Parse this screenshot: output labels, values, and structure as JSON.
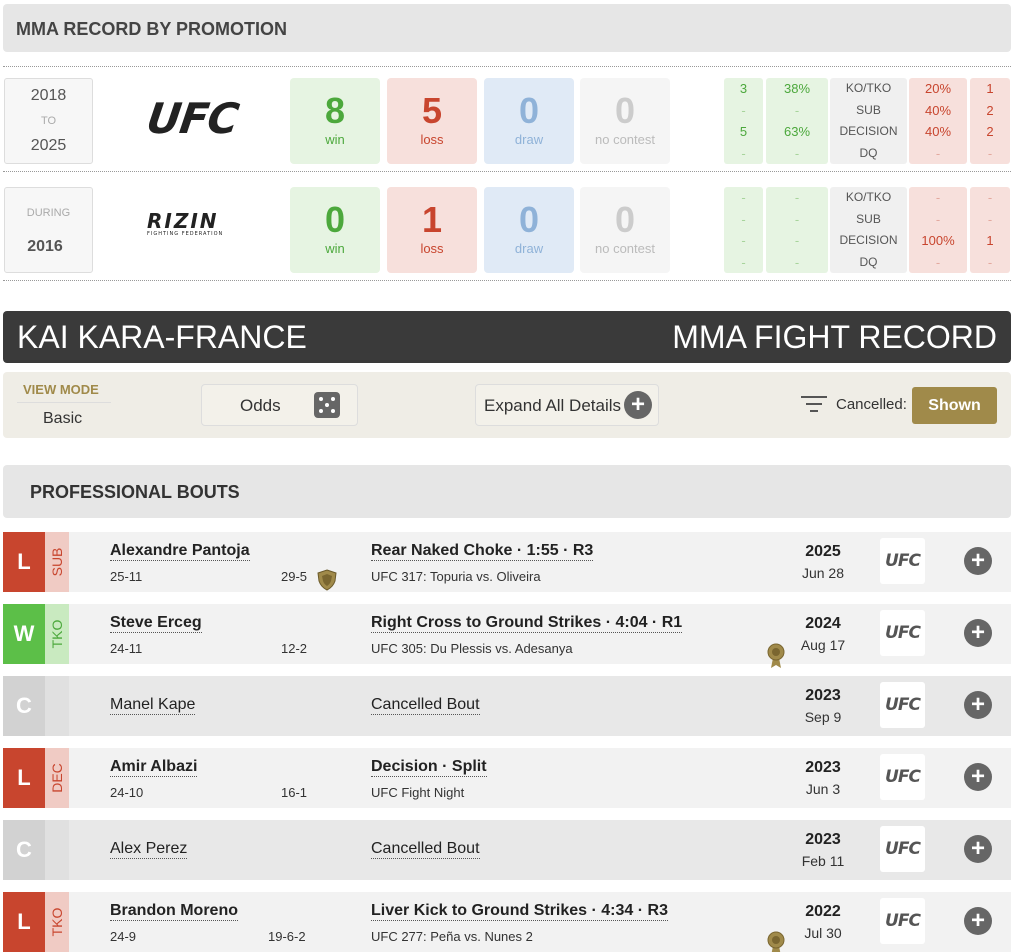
{
  "promotion_section": {
    "title": "MMA RECORD BY PROMOTION",
    "rows": [
      {
        "years": {
          "from": "2018",
          "to_label": "TO",
          "to": "2025"
        },
        "logo": "UFC",
        "win": "8",
        "win_label": "win",
        "loss": "5",
        "loss_label": "loss",
        "draw": "0",
        "draw_label": "draw",
        "nc": "0",
        "nc_label": "no contest",
        "win_methods": [
          "3",
          "-",
          "5",
          "-"
        ],
        "win_pct": [
          "38%",
          "-",
          "63%",
          "-"
        ],
        "method_labels": [
          "KO/TKO",
          "SUB",
          "DECISION",
          "DQ"
        ],
        "loss_pct": [
          "20%",
          "40%",
          "40%",
          "-"
        ],
        "loss_methods": [
          "1",
          "2",
          "2",
          "-"
        ]
      },
      {
        "years": {
          "during_label": "DURING",
          "year": "2016"
        },
        "logo": "RIZIN",
        "logo_sub": "FIGHTING FEDERATION",
        "win": "0",
        "win_label": "win",
        "loss": "1",
        "loss_label": "loss",
        "draw": "0",
        "draw_label": "draw",
        "nc": "0",
        "nc_label": "no contest",
        "win_methods": [
          "-",
          "-",
          "-",
          "-"
        ],
        "win_pct": [
          "-",
          "-",
          "-",
          "-"
        ],
        "method_labels": [
          "KO/TKO",
          "SUB",
          "DECISION",
          "DQ"
        ],
        "loss_pct": [
          "-",
          "-",
          "100%",
          "-"
        ],
        "loss_methods": [
          "-",
          "-",
          "1",
          "-"
        ]
      }
    ]
  },
  "banner": {
    "fighter_name": "KAI KARA-FRANCE",
    "record_label": "MMA FIGHT RECORD"
  },
  "toolbar": {
    "view_mode_label": "VIEW MODE",
    "view_mode_value": "Basic",
    "odds_label": "Odds",
    "expand_label": "Expand All Details",
    "cancelled_label": "Cancelled:",
    "shown_label": "Shown"
  },
  "bouts_section": {
    "title": "PROFESSIONAL BOUTS",
    "bouts": [
      {
        "result": "L",
        "method": "SUB",
        "opponent": "Alexandre Pantoja",
        "fighter_record": "25-11",
        "opponent_record": "29-5",
        "finish": "Rear Naked Choke · 1:55 · R3",
        "event": "UFC 317: Topuria vs. Oliveira",
        "year": "2025",
        "date": "Jun 28",
        "promotion": "UFC"
      },
      {
        "result": "W",
        "method": "TKO",
        "opponent": "Steve Erceg",
        "fighter_record": "24-11",
        "opponent_record": "12-2",
        "finish": "Right Cross to Ground Strikes · 4:04 · R1",
        "event": "UFC 305: Du Plessis vs. Adesanya",
        "year": "2024",
        "date": "Aug 17",
        "promotion": "UFC"
      },
      {
        "result": "C",
        "method": "",
        "opponent": "Manel Kape",
        "finish": "Cancelled Bout",
        "year": "2023",
        "date": "Sep 9",
        "promotion": "UFC"
      },
      {
        "result": "L",
        "method": "DEC",
        "opponent": "Amir Albazi",
        "fighter_record": "24-10",
        "opponent_record": "16-1",
        "finish": "Decision · Split",
        "event": "UFC Fight Night",
        "year": "2023",
        "date": "Jun 3",
        "promotion": "UFC"
      },
      {
        "result": "C",
        "method": "",
        "opponent": "Alex Perez",
        "finish": "Cancelled Bout",
        "year": "2023",
        "date": "Feb 11",
        "promotion": "UFC"
      },
      {
        "result": "L",
        "method": "TKO",
        "opponent": "Brandon Moreno",
        "fighter_record": "24-9",
        "opponent_record": "19-6-2",
        "finish": "Liver Kick to Ground Strikes · 4:34 · R3",
        "event": "UFC 277: Peña vs. Nunes 2",
        "year": "2022",
        "date": "Jul 30",
        "promotion": "UFC"
      }
    ]
  },
  "colors": {
    "win": "#5cbf48",
    "loss": "#c8452e",
    "gold_accent": "#a08a4a",
    "banner_bg": "#3a3a3a"
  },
  "icons": [
    "dice-icon",
    "plus-icon",
    "filter-icon",
    "shield-icon",
    "medal-icon"
  ]
}
